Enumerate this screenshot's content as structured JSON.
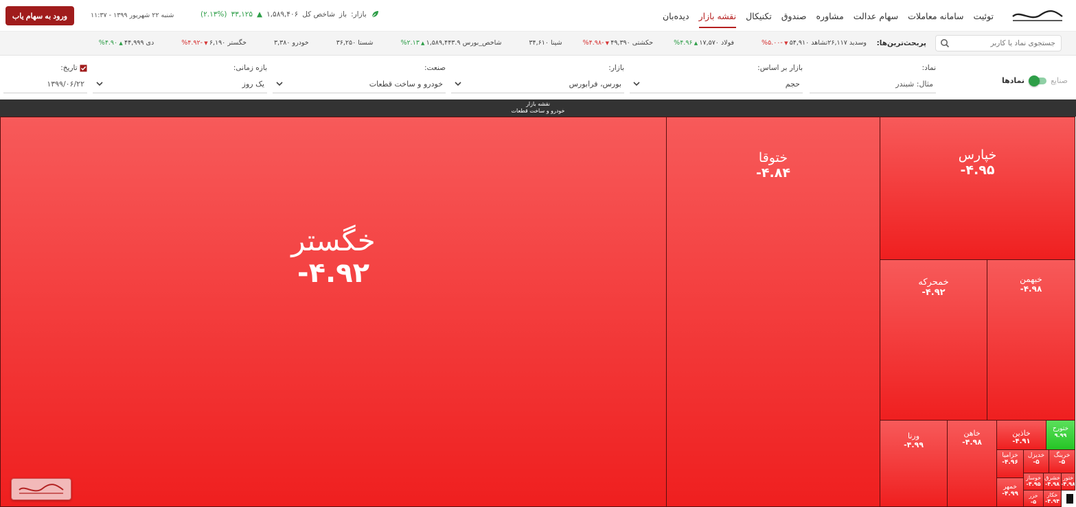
{
  "nav": {
    "logo": "سهام یاب",
    "menu": [
      "توئیت",
      "سامانه معاملات",
      "سهام عدالت",
      "مشاوره",
      "صندوق",
      "تکنیکال",
      "نقشه بازار",
      "دیده‌بان"
    ],
    "active_menu": "نقشه بازار",
    "market_label": "بازار:",
    "market_state": "باز",
    "index_label": "شاخص کل",
    "index_value": "۱,۵۸۹,۴۰۶",
    "index_change": "۳۳,۱۲۵",
    "index_change_pct": "(۲.۱۳%)",
    "datetime": "شنبه ۲۲ شهریور ۱۳۹۹ - ۱۱:۳۷",
    "login_label": "ورود به سهام یاب"
  },
  "ticker": {
    "search_placeholder": "جستجوی نماد یا کاربر",
    "label": "پربحث‌ترین‌ها:",
    "items": [
      {
        "text": "دی ۴۴,۹۹۹",
        "dir": "up",
        "chg": "۴.۹۰%"
      },
      {
        "text": "خگستر ۶,۱۹۰",
        "dir": "down",
        "chg": "-۴.۹۲%"
      },
      {
        "text": "خودرو ۳,۳۸۰",
        "dir": "",
        "chg": ""
      },
      {
        "text": "شستا ۳۶,۲۵۰",
        "dir": "",
        "chg": ""
      },
      {
        "text": "شاخص_بورس ۱,۵۸۹,۴۴۳.۹",
        "dir": "up",
        "chg": "۲.۱۳%"
      },
      {
        "text": "شپنا ۳۴,۶۱۰",
        "dir": "",
        "chg": ""
      },
      {
        "text": "حکشتی ۴۹,۳۹۰",
        "dir": "down",
        "chg": "-۴.۹۸%"
      },
      {
        "text": "فولاد ۱۷,۵۷۰",
        "dir": "up",
        "chg": "۴.۹۶%"
      },
      {
        "text": "تشاهد ۵۴,۹۱۰",
        "dir": "down",
        "chg": "-۵.۰۰%"
      },
      {
        "text": "وسدید ۲۶,۱۱۷",
        "dir": "",
        "chg": ""
      }
    ]
  },
  "filters": {
    "toggle_off": "صنایع",
    "toggle_on": "نمادها",
    "symbol_label": "نماد:",
    "symbol_placeholder": "مثال: شبندر",
    "basis_label": "بازار بر اساس:",
    "basis_value": "حجم",
    "market_label": "بازار:",
    "market_value": "بورس، فرابورس",
    "industry_label": "صنعت:",
    "industry_value": "خودرو و ساخت قطعات",
    "period_label": "بازه زمانی:",
    "period_value": "یک روز",
    "date_label": "تاریخ:",
    "date_value": "۱۳۹۹/۰۶/۲۲"
  },
  "treemap": {
    "title": "نقشه بازار",
    "subtitle": "خودرو و ساخت قطعات",
    "tiles": [
      {
        "name": "خگستر",
        "pct": "-۴.۹۲",
        "color": "red"
      },
      {
        "name": "ختوقا",
        "pct": "-۴.۸۴",
        "color": "red"
      },
      {
        "name": "خپارس",
        "pct": "-۴.۹۵",
        "color": "red"
      },
      {
        "name": "خمحرکه",
        "pct": "-۴.۹۲",
        "color": "red"
      },
      {
        "name": "خبهمن",
        "pct": "-۴.۹۸",
        "color": "red"
      },
      {
        "name": "ورنا",
        "pct": "-۴.۹۹",
        "color": "red"
      },
      {
        "name": "خاهن",
        "pct": "-۴.۹۸",
        "color": "red"
      },
      {
        "name": "خاذین",
        "pct": "-۴.۹۱",
        "color": "red"
      },
      {
        "name": "ختورح",
        "pct": "۹.۹۹",
        "color": "green"
      },
      {
        "name": "خزامیا",
        "pct": "-۴.۹۶",
        "color": "red"
      },
      {
        "name": "خدیزل",
        "pct": "-۵",
        "color": "red"
      },
      {
        "name": "خرینگ",
        "pct": "-۵",
        "color": "red"
      },
      {
        "name": "خمهر",
        "pct": "-۴.۹۹",
        "color": "red"
      },
      {
        "name": "خوساز",
        "pct": "-۴.۹۵",
        "color": "red"
      },
      {
        "name": "خشرق",
        "pct": "-۴.۹۸",
        "color": "red"
      },
      {
        "name": "ختور",
        "pct": "-۴.۹۸",
        "color": "red"
      },
      {
        "name": "خزر",
        "pct": "-۵",
        "color": "red"
      },
      {
        "name": "خکار",
        "pct": "-۴.۹۴",
        "color": "red"
      }
    ]
  },
  "watermark": "سهام یاب"
}
